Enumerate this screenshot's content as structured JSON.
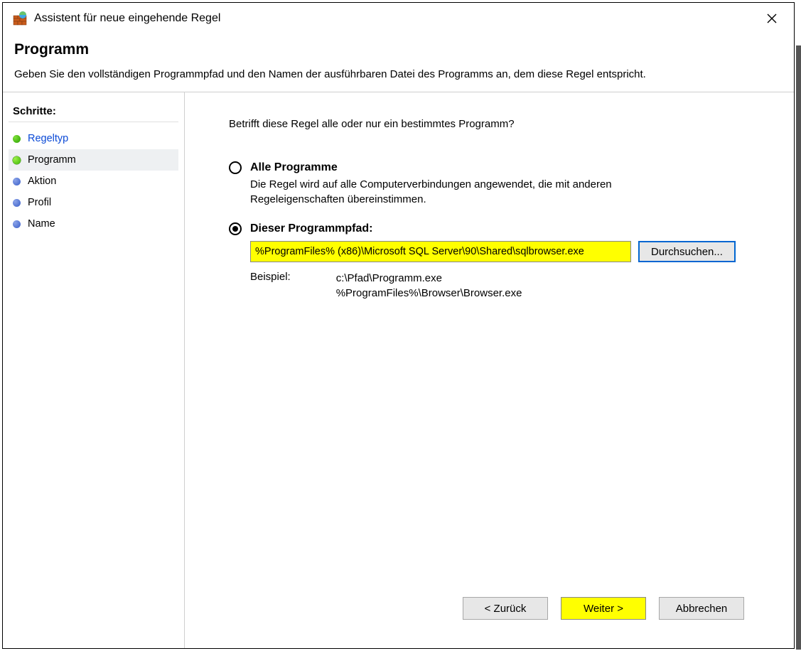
{
  "window": {
    "title": "Assistent für neue eingehende Regel"
  },
  "header": {
    "title": "Programm",
    "subtitle": "Geben Sie den vollständigen Programmpfad und den Namen der ausführbaren Datei des Programms an, dem diese Regel entspricht."
  },
  "sidebar": {
    "heading": "Schritte:",
    "steps": [
      {
        "label": "Regeltyp",
        "state": "completed"
      },
      {
        "label": "Programm",
        "state": "current"
      },
      {
        "label": "Aktion",
        "state": "upcoming"
      },
      {
        "label": "Profil",
        "state": "upcoming"
      },
      {
        "label": "Name",
        "state": "upcoming"
      }
    ]
  },
  "content": {
    "question": "Betrifft diese Regel alle oder nur ein bestimmtes Programm?",
    "options": {
      "all": {
        "label": "Alle Programme",
        "desc": "Die Regel wird auf alle Computerverbindungen angewendet, die mit anderen Regeleigenschaften übereinstimmen.",
        "selected": false
      },
      "path": {
        "label": "Dieser Programmpfad:",
        "value": "%ProgramFiles% (x86)\\Microsoft SQL Server\\90\\Shared\\sqlbrowser.exe",
        "browse_label": "Durchsuchen...",
        "selected": true,
        "example_label": "Beispiel:",
        "example_line1": "c:\\Pfad\\Programm.exe",
        "example_line2": "%ProgramFiles%\\Browser\\Browser.exe"
      }
    }
  },
  "footer": {
    "back": "< Zurück",
    "next": "Weiter >",
    "cancel": "Abbrechen"
  }
}
